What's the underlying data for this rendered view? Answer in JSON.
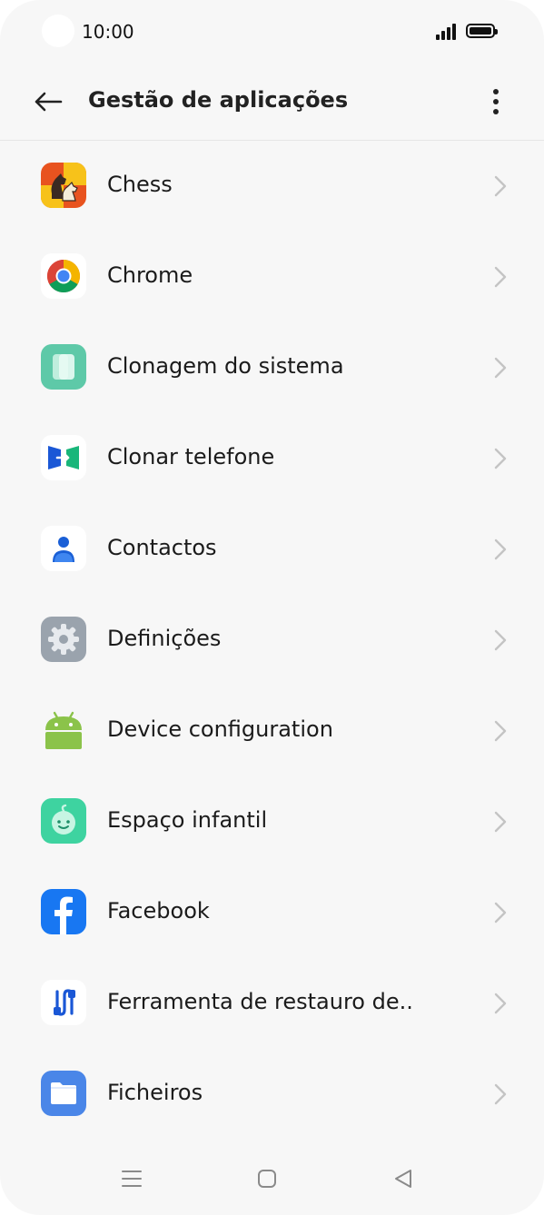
{
  "status_bar": {
    "time": "10:00"
  },
  "app_bar": {
    "title": "Gestão de aplicações"
  },
  "apps": [
    {
      "label": "Chess",
      "icon": "chess-icon"
    },
    {
      "label": "Chrome",
      "icon": "chrome-icon"
    },
    {
      "label": "Clonagem do sistema",
      "icon": "clone-system-icon"
    },
    {
      "label": "Clonar telefone",
      "icon": "clone-phone-icon"
    },
    {
      "label": "Contactos",
      "icon": "contacts-icon"
    },
    {
      "label": "Definições",
      "icon": "settings-gear-icon"
    },
    {
      "label": "Device configuration",
      "icon": "android-icon"
    },
    {
      "label": "Espaço infantil",
      "icon": "kids-space-icon"
    },
    {
      "label": "Facebook",
      "icon": "facebook-icon"
    },
    {
      "label": "Ferramenta de restauro de..",
      "icon": "restore-tool-icon"
    },
    {
      "label": "Ficheiros",
      "icon": "files-folder-icon"
    }
  ],
  "colors": {
    "background": "#f7f7f7",
    "text": "#1b1b1b",
    "chevron": "#c4c4c4",
    "chrome_red": "#db4437",
    "chrome_yellow": "#f4b400",
    "chrome_green": "#0f9d58",
    "chrome_blue": "#4285f4",
    "facebook_blue": "#1877f2",
    "files_blue": "#4a86e8",
    "kids_green": "#3ed3a0",
    "clone_green": "#5ec9a8",
    "android_green": "#8bc34a"
  }
}
